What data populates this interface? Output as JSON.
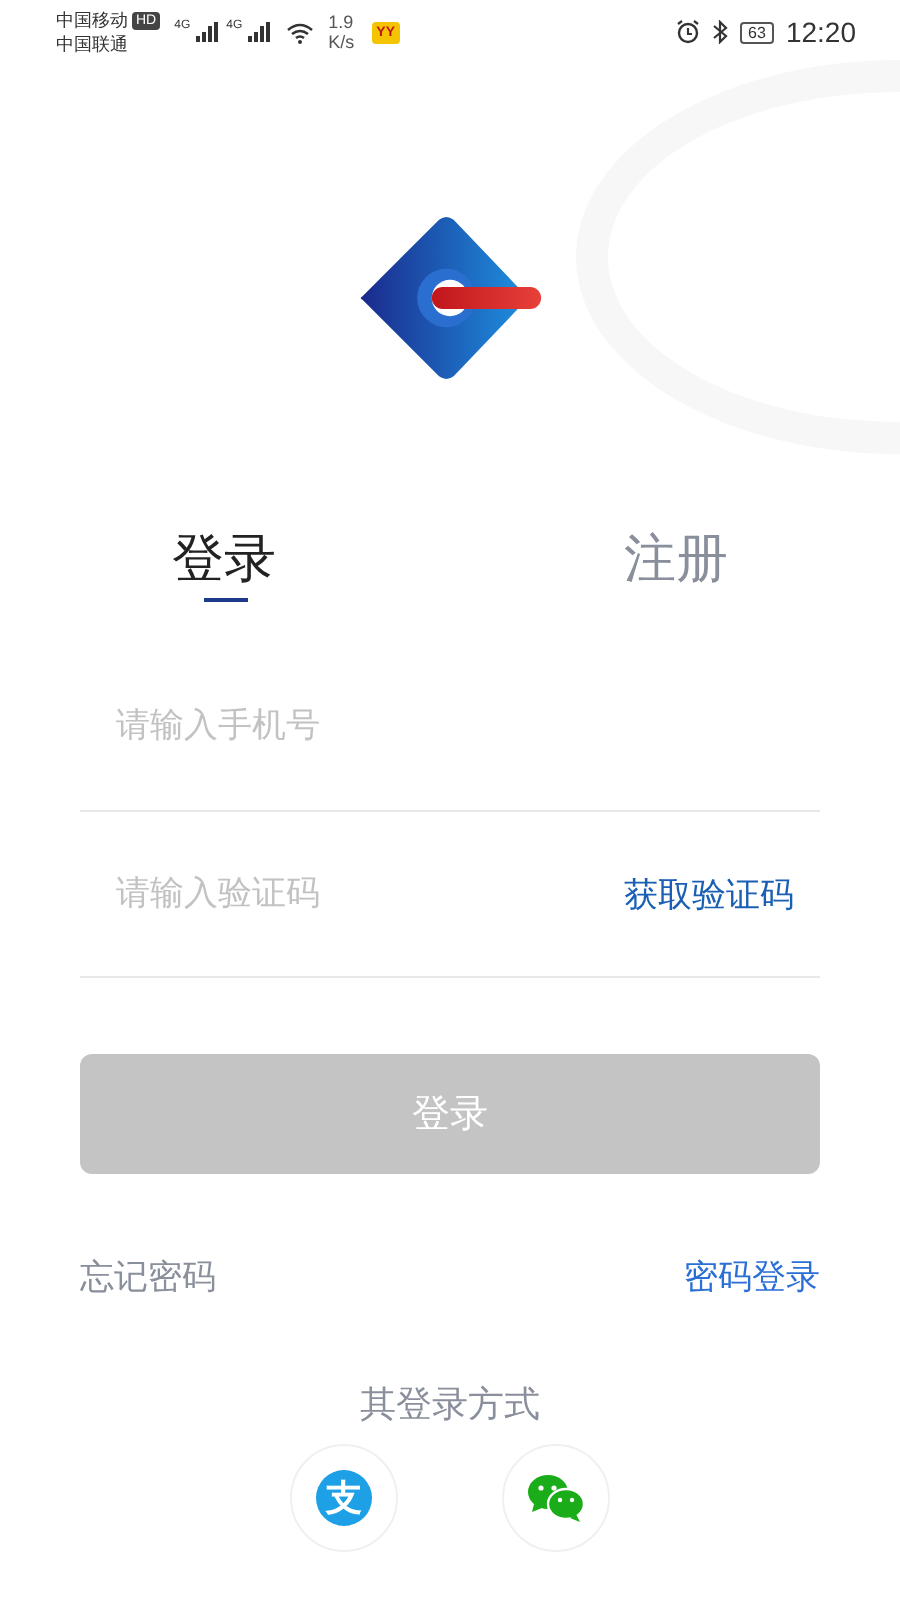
{
  "status_bar": {
    "carrier_1": "中国移动",
    "hd": "HD",
    "carrier_2": "中国联通",
    "network_1": "4G",
    "network_2": "4G",
    "speed_value": "1.9",
    "speed_unit": "K/s",
    "app_badge": "YY",
    "battery": "63",
    "time": "12:20"
  },
  "tabs": [
    {
      "label": "登录",
      "selected": true
    },
    {
      "label": "注册",
      "selected": false
    }
  ],
  "fields": [
    {
      "placeholder": "请输入手机号"
    },
    {
      "placeholder": "请输入验证码",
      "action": "获取验证码"
    }
  ],
  "login_button": {
    "label": "登录",
    "disabled": true
  },
  "links": {
    "forgot": "忘记密码",
    "password_login": "密码登录"
  },
  "other_methods": {
    "title": "其登录方式",
    "alipay_glyph": "支"
  }
}
